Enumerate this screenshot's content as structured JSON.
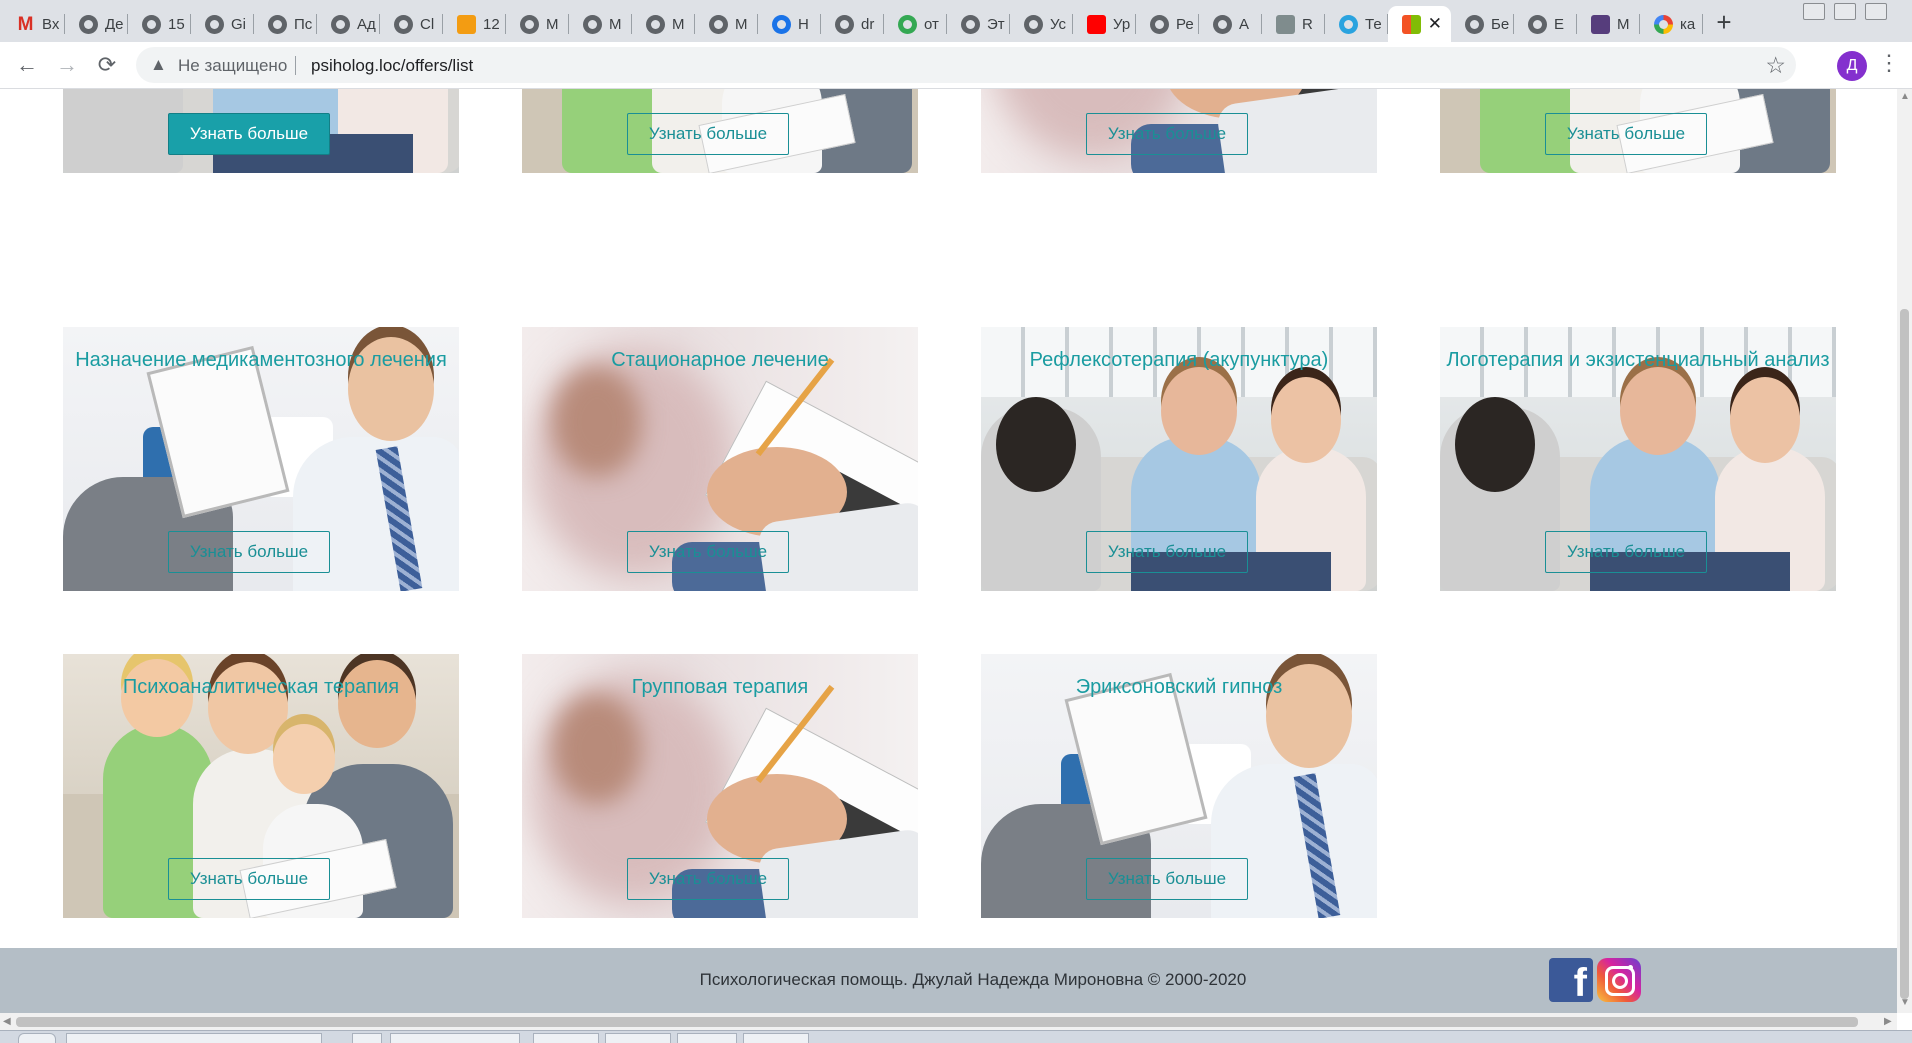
{
  "browser": {
    "tabs": [
      {
        "label": "Вх",
        "icon": "gmail-icon"
      },
      {
        "label": "Де",
        "icon": "globe-icon"
      },
      {
        "label": "15",
        "icon": "globe-icon"
      },
      {
        "label": "Gi",
        "icon": "globe-icon"
      },
      {
        "label": "Пс",
        "icon": "globe-icon"
      },
      {
        "label": "Ад",
        "icon": "globe-icon"
      },
      {
        "label": "Cl",
        "icon": "globe-icon"
      },
      {
        "label": "12",
        "icon": "pma-icon"
      },
      {
        "label": "M",
        "icon": "globe-icon"
      },
      {
        "label": "M",
        "icon": "globe-icon"
      },
      {
        "label": "M",
        "icon": "globe-icon"
      },
      {
        "label": "M",
        "icon": "globe-icon"
      },
      {
        "label": "Н",
        "icon": "gear-icon"
      },
      {
        "label": "dr",
        "icon": "globe-icon"
      },
      {
        "label": "от",
        "icon": "maps-pin-icon"
      },
      {
        "label": "Эт",
        "icon": "globe-icon"
      },
      {
        "label": "Ус",
        "icon": "globe-icon"
      },
      {
        "label": "Ур",
        "icon": "youtube-icon"
      },
      {
        "label": "Ре",
        "icon": "globe-icon"
      },
      {
        "label": "А",
        "icon": "globe-icon"
      },
      {
        "label": "R",
        "icon": "document-icon"
      },
      {
        "label": "Те",
        "icon": "telegram-icon"
      },
      {
        "label": "",
        "icon": "windows-icon",
        "active": true
      },
      {
        "label": "Бе",
        "icon": "web-icon"
      },
      {
        "label": "Е",
        "icon": "globe-icon"
      },
      {
        "label": "М",
        "icon": "bootstrap-icon"
      },
      {
        "label": "ка",
        "icon": "google-icon"
      }
    ],
    "new_tab": "+",
    "back": "←",
    "forward": "→",
    "reload": "⟳",
    "warning": "▲",
    "security_status": "Не защищено",
    "url": "psiholog.loc/offers/list",
    "star": "☆",
    "profile_initial": "Д",
    "menu": "⋮"
  },
  "colors": {
    "accent": "#1a9ca1",
    "button_fill": "#19a0a9",
    "footer_bg": "#b4bec6"
  },
  "offers_top_row": [
    {
      "button": "Узнать больше",
      "photo": "couple"
    },
    {
      "button": "Узнать больше",
      "photo": "family"
    },
    {
      "button": "Узнать больше",
      "photo": "notes"
    },
    {
      "button": "Узнать больше",
      "photo": "family"
    }
  ],
  "offers_row2": [
    {
      "title": "Назначение медикаментозного лечения",
      "button": "Узнать больше",
      "photo": "tie"
    },
    {
      "title": "Стационарное лечение",
      "button": "Узнать больше",
      "photo": "notes"
    },
    {
      "title": "Рефлексотерапия (акупунктура)",
      "button": "Узнать больше",
      "photo": "couple"
    },
    {
      "title": "Логотерапия и экзистенциальный анализ",
      "button": "Узнать больше",
      "photo": "couple"
    }
  ],
  "offers_row3": [
    {
      "title": "Психоаналитическая терапия",
      "button": "Узнать больше",
      "photo": "family"
    },
    {
      "title": "Групповая терапия",
      "button": "Узнать больше",
      "photo": "notes"
    },
    {
      "title": "Эриксоновский гипноз",
      "button": "Узнать больше",
      "photo": "tie"
    }
  ],
  "footer": {
    "copyright": "Психологическая помощь. Джулай Надежда Мироновна © 2000-2020",
    "social": [
      "facebook-icon",
      "instagram-icon"
    ],
    "facebook_glyph": "f"
  }
}
